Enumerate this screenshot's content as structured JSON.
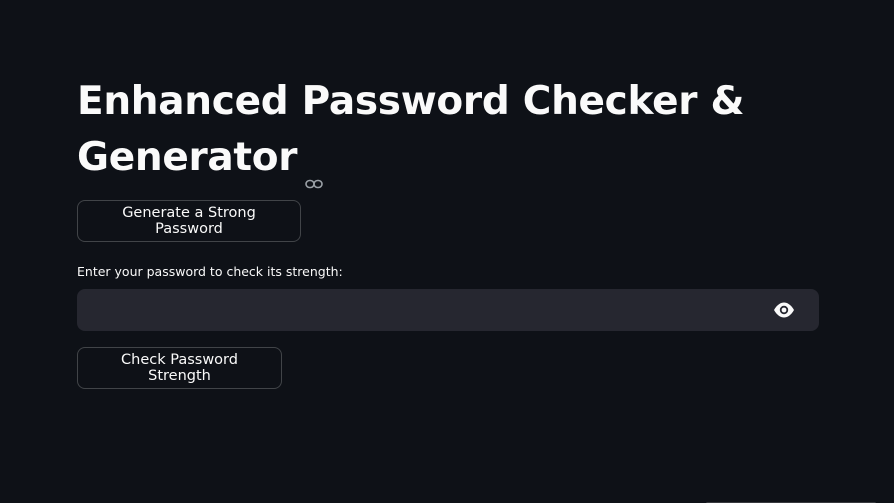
{
  "app": {
    "title_line1": "Enhanced Password Checker &",
    "title_line2": "Generator"
  },
  "generate_button": {
    "label": "Generate a Strong Password"
  },
  "password_field": {
    "label": "Enter your password to check its strength:",
    "value": "",
    "placeholder": ""
  },
  "check_button": {
    "label": "Check Password Strength"
  },
  "icons": {
    "anchor": "link-icon",
    "toggle": "eye-icon"
  },
  "colors": {
    "background": "#0e1117",
    "input_background": "#262730",
    "text": "#fafafa"
  }
}
